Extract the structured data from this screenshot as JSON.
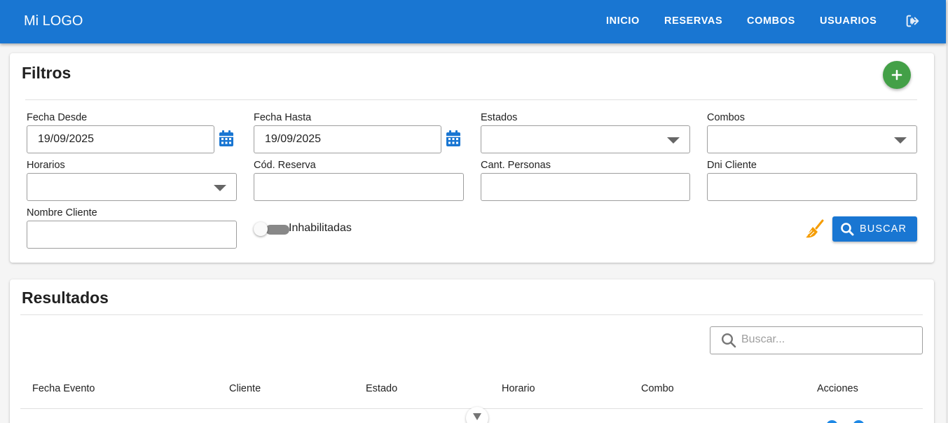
{
  "navbar": {
    "logo": "Mi LOGO",
    "links": [
      "INICIO",
      "RESERVAS",
      "COMBOS",
      "USUARIOS"
    ],
    "logout_icon": "logout-icon"
  },
  "filters": {
    "title": "Filtros",
    "add_icon": "plus-icon",
    "fecha_desde": {
      "label": "Fecha Desde",
      "value": "19/09/2025"
    },
    "fecha_hasta": {
      "label": "Fecha Hasta",
      "value": "19/09/2025"
    },
    "estados": {
      "label": "Estados",
      "value": ""
    },
    "combos": {
      "label": "Combos",
      "value": ""
    },
    "horarios": {
      "label": "Horarios",
      "value": ""
    },
    "cod_reserva": {
      "label": "Cód. Reserva",
      "value": ""
    },
    "cant_personas": {
      "label": "Cant. Personas",
      "value": ""
    },
    "dni_cliente": {
      "label": "Dni Cliente",
      "value": ""
    },
    "nombre_cliente": {
      "label": "Nombre Cliente",
      "value": ""
    },
    "inhabilitadas": {
      "label": "Inhabilitadas",
      "checked": false
    },
    "clear_icon": "broom-icon",
    "search_button": "BUSCAR"
  },
  "results": {
    "title": "Resultados",
    "search_placeholder": "Buscar...",
    "columns": [
      "Fecha Evento",
      "Cliente",
      "Estado",
      "Horario",
      "Combo",
      "Acciones"
    ]
  },
  "colors": {
    "primary": "#1976d2",
    "add_button": "#43a047",
    "clear_icon": "#f59c00"
  }
}
